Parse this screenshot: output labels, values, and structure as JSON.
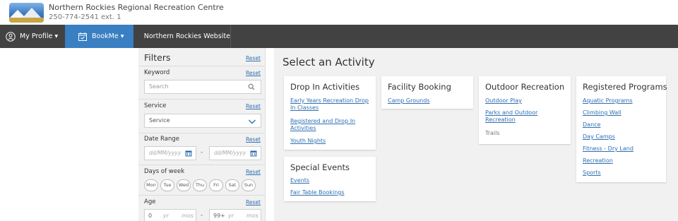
{
  "header": {
    "site_name": "Northern Rockies Regional Recreation Centre",
    "phone": "250-774-2541 ext. 1"
  },
  "navbar": {
    "profile_label": "My Profile ▾",
    "bookme_label": "BookMe ▾",
    "website_label": "Northern Rockies Website",
    "bookme_color": "#3a7fc1",
    "bar_color": "#424242"
  },
  "filters": {
    "title": "Filters",
    "reset_label": "Reset",
    "keyword": {
      "label": "Keyword",
      "placeholder": "Search"
    },
    "service": {
      "label": "Service",
      "value": "Service"
    },
    "date_range": {
      "label": "Date Range",
      "from_placeholder": "dd/MM/yyyy",
      "to_placeholder": "dd/MM/yyyy",
      "separator": "-"
    },
    "days_of_week": {
      "label": "Days of week",
      "days": [
        "Mon",
        "Tue",
        "Wed",
        "Thu",
        "Fri",
        "Sat",
        "Sun"
      ]
    },
    "age": {
      "label": "Age",
      "min_value": "0",
      "min_unit": "yr",
      "min_mos": "mos",
      "max_value": "99+",
      "max_unit": "yr",
      "max_mos": "mos",
      "separator": "-"
    }
  },
  "main": {
    "title": "Select an Activity",
    "cards": {
      "drop_in": {
        "title": "Drop In Activities",
        "links": [
          "Early Years Recreation Drop In Classes",
          "Registered and Drop In Activities",
          "Youth Nights"
        ]
      },
      "special_events": {
        "title": "Special Events",
        "links": [
          "Events",
          "Fair Table Bookings"
        ]
      },
      "facility": {
        "title": "Facility Booking",
        "links": [
          "Camp Grounds"
        ]
      },
      "outdoor": {
        "title": "Outdoor Recreation",
        "links": [
          "Outdoor Play",
          "Parks and Outdoor Recreation"
        ],
        "plain": [
          "Trails"
        ]
      },
      "registered": {
        "title": "Registered Programs",
        "links": [
          "Aquatic Programs",
          "Climbing Wall",
          "Dance",
          "Day Camps",
          "Fitness - Dry Land",
          "Recreation",
          "Sports"
        ]
      }
    }
  },
  "colors": {
    "link": "#2f6fb1",
    "panel_bg": "#f1f1f1"
  },
  "icons": [
    "person-icon",
    "calendar-check-icon",
    "globe-icon",
    "search-icon",
    "chevron-down-icon",
    "calendar-icon"
  ]
}
